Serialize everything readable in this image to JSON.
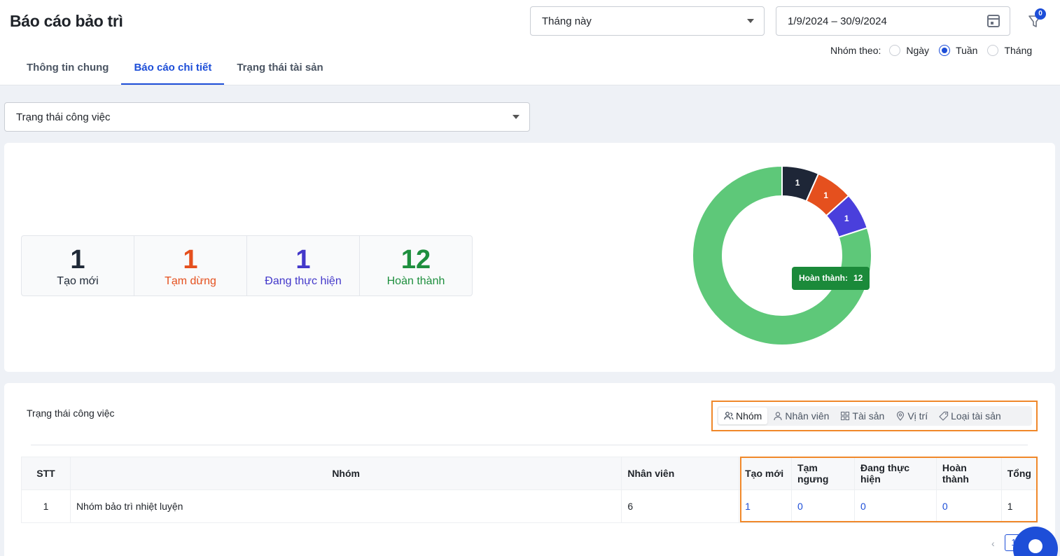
{
  "page": {
    "title": "Báo cáo bảo trì"
  },
  "tabs": [
    {
      "label": "Thông tin chung",
      "active": false
    },
    {
      "label": "Báo cáo chi tiết",
      "active": true
    },
    {
      "label": "Trạng thái tài sản",
      "active": false
    }
  ],
  "filters": {
    "period": "Tháng này",
    "date_range": "1/9/2024 – 30/9/2024",
    "filter_badge": "0",
    "group_by_label": "Nhóm theo:",
    "group_by_options": [
      {
        "label": "Ngày",
        "checked": false
      },
      {
        "label": "Tuần",
        "checked": true
      },
      {
        "label": "Tháng",
        "checked": false
      }
    ],
    "status_select": "Trạng thái công việc"
  },
  "stats": [
    {
      "value": "1",
      "label": "Tạo mới",
      "color": "#1f2937"
    },
    {
      "value": "1",
      "label": "Tạm dừng",
      "color": "#e5501e"
    },
    {
      "value": "1",
      "label": "Đang thực hiện",
      "color": "#4338ca"
    },
    {
      "value": "12",
      "label": "Hoàn thành",
      "color": "#1e8f3e"
    }
  ],
  "chart_data": {
    "type": "pie",
    "categories": [
      "Tạo mới",
      "Tạm dừng",
      "Đang thực hiện",
      "Hoàn thành"
    ],
    "values": [
      1,
      1,
      1,
      12
    ],
    "colors": [
      "#1e2637",
      "#e5501e",
      "#4a3fdc",
      "#5ec879"
    ],
    "donut": true
  },
  "tooltip": {
    "label": "Hoàn thành:",
    "value": "12"
  },
  "table_section": {
    "title": "Trạng thái công việc",
    "views": [
      {
        "label": "Nhóm",
        "icon": "group-icon",
        "active": true
      },
      {
        "label": "Nhân viên",
        "icon": "user-icon",
        "active": false
      },
      {
        "label": "Tài sản",
        "icon": "grid-icon",
        "active": false
      },
      {
        "label": "Vị trí",
        "icon": "location-pin-icon",
        "active": false
      },
      {
        "label": "Loại tài sản",
        "icon": "tag-icon",
        "active": false
      }
    ],
    "columns": [
      "STT",
      "Nhóm",
      "Nhân viên",
      "Tạo mới",
      "Tạm ngưng",
      "Đang thực hiện",
      "Hoàn thành",
      "Tổng"
    ],
    "rows": [
      {
        "stt": "1",
        "group": "Nhóm bảo trì nhiệt luyện",
        "staff": "6",
        "new": "1",
        "paused": "0",
        "in_progress": "0",
        "done": "0",
        "total": "1"
      }
    ]
  },
  "pagination": {
    "prev": "‹",
    "current": "1"
  }
}
